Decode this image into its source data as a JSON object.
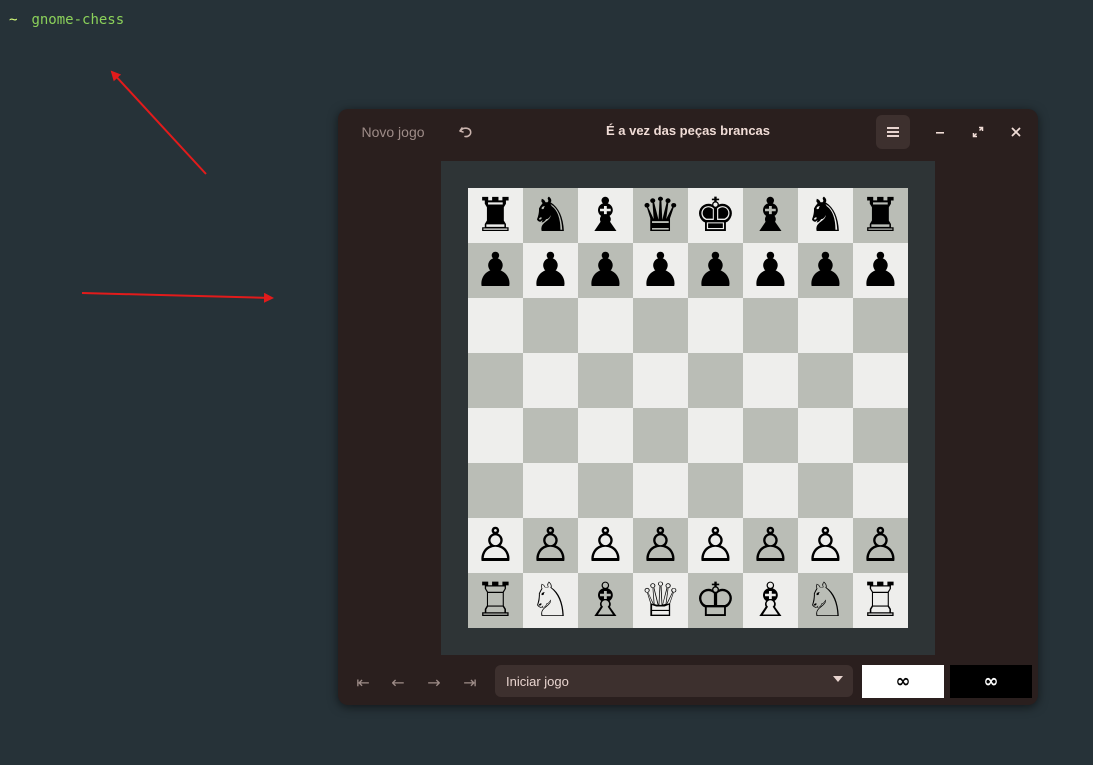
{
  "terminal": {
    "prompt": "~",
    "command": "gnome-chess"
  },
  "window": {
    "new_game_label": "Novo jogo",
    "title": "É a vez das peças brancas",
    "undo_icon": "undo-icon",
    "menu_icon": "hamburger-menu-icon",
    "minimize_icon": "minimize-icon",
    "maximize_icon": "maximize-icon",
    "close_icon": "close-icon"
  },
  "board": {
    "rows": [
      [
        "♜",
        "♞",
        "♝",
        "♛",
        "♚",
        "♝",
        "♞",
        "♜"
      ],
      [
        "♟",
        "♟",
        "♟",
        "♟",
        "♟",
        "♟",
        "♟",
        "♟"
      ],
      [
        "",
        "",
        "",
        "",
        "",
        "",
        "",
        ""
      ],
      [
        "",
        "",
        "",
        "",
        "",
        "",
        "",
        ""
      ],
      [
        "",
        "",
        "",
        "",
        "",
        "",
        "",
        ""
      ],
      [
        "",
        "",
        "",
        "",
        "",
        "",
        "",
        ""
      ],
      [
        "♙",
        "♙",
        "♙",
        "♙",
        "♙",
        "♙",
        "♙",
        "♙"
      ],
      [
        "♖",
        "♘",
        "♗",
        "♕",
        "♔",
        "♗",
        "♘",
        "♖"
      ]
    ],
    "light_color": "#eeeeec",
    "dark_color": "#babdb6"
  },
  "footer": {
    "nav_first": "⇤",
    "nav_prev": "←",
    "nav_next": "→",
    "nav_last": "⇥",
    "history_selected": "Iniciar jogo",
    "white_clock": "∞",
    "black_clock": "∞"
  },
  "colors": {
    "desktop_bg": "#263238",
    "window_bg": "#2a1f1e",
    "annotation_arrow": "#e21b1b"
  }
}
